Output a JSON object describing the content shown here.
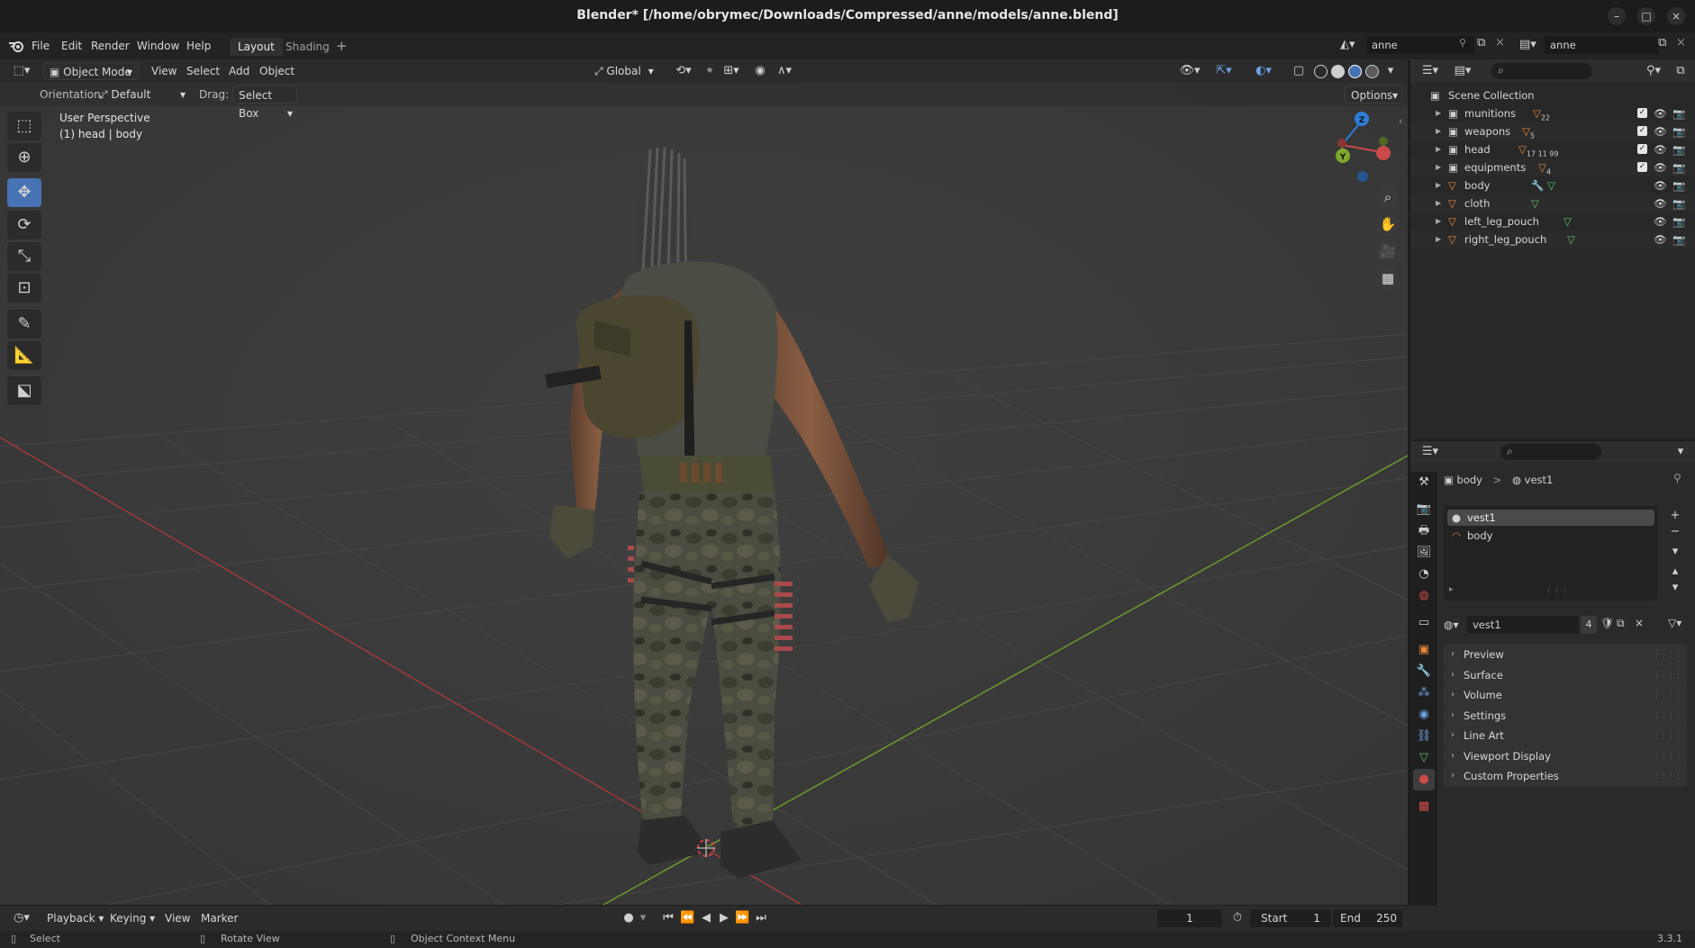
{
  "window": {
    "title": "Blender* [/home/obrymec/Downloads/Compressed/anne/models/anne.blend]",
    "minimize": "–",
    "restore": "□",
    "close": "×"
  },
  "menubar": {
    "items": [
      "File",
      "Edit",
      "Render",
      "Window",
      "Help"
    ],
    "workspaces": [
      "Layout",
      "Shading"
    ],
    "add_workspace": "+",
    "scene": "anne",
    "view_layer": "anne"
  },
  "viewport": {
    "mode": "Object Mode",
    "menus": [
      "View",
      "Select",
      "Add",
      "Object"
    ],
    "transform_orientation": "Global",
    "orientation_label": "Orientation:",
    "orientation_value": "Default",
    "drag_label": "Drag:",
    "drag_value": "Select Box",
    "options": "Options",
    "perspective": "User Perspective",
    "context": "(1) head | body",
    "axis_labels": {
      "z": "Z",
      "y": "Y",
      "x": "X"
    }
  },
  "outliner": {
    "root": "Scene Collection",
    "rows": [
      {
        "name": "munitions",
        "badge": "22"
      },
      {
        "name": "weapons",
        "badge": "5"
      },
      {
        "name": "head",
        "badge": "17  11  99"
      },
      {
        "name": "equipments",
        "badge": "4"
      },
      {
        "name": "body",
        "badge": ""
      },
      {
        "name": "cloth",
        "badge": ""
      },
      {
        "name": "left_leg_pouch",
        "badge": ""
      },
      {
        "name": "right_leg_pouch",
        "badge": ""
      }
    ]
  },
  "properties": {
    "breadcrumb_object": "body",
    "breadcrumb_sep": ">",
    "breadcrumb_material": "vest1",
    "slots": [
      "vest1",
      "body"
    ],
    "material_name": "vest1",
    "user_count": "4",
    "panels": [
      "Preview",
      "Surface",
      "Volume",
      "Settings",
      "Line Art",
      "Viewport Display",
      "Custom Properties"
    ]
  },
  "timeline": {
    "menus": [
      "Playback",
      "Keying",
      "View",
      "Marker"
    ],
    "current_frame": "1",
    "start_label": "Start",
    "start": "1",
    "end_label": "End",
    "end": "250"
  },
  "statusbar": {
    "left": "Select",
    "middle": "Rotate View",
    "right": "Object Context Menu",
    "version": "3.3.1"
  },
  "colors": {
    "accent": "#4772b3",
    "x_axis": "#c94a4a",
    "y_axis": "#7fa82e",
    "z_axis": "#2f7bd8",
    "orange_object": "#e8873a",
    "green_data": "#5ec46c"
  }
}
